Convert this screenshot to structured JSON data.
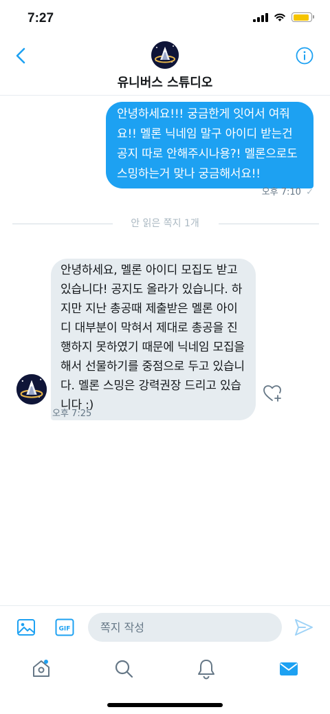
{
  "status_bar": {
    "time": "7:27"
  },
  "header": {
    "title": "유니버스 스튜디오"
  },
  "messages": [
    {
      "direction": "sent",
      "text": "안녕하세요!!! 궁금한게 잇어서 여줘요!! 멜론 닉네임 말구 아이디 받는건 공지 따로 안해주시나용?! 멜론으로도 스밍하는거 맞나 궁금해서요!!",
      "time": "오후 7:10",
      "check": "✓"
    },
    {
      "direction": "received",
      "text": "안녕하세요, 멜론 아이디 모집도 받고 있습니다! 공지도 올라가 있습니다. 하지만 지난 총공때 제출받은 멜론 아이디 대부분이 막혀서 제대로 총공을 진행하지 못하였기 때문에 닉네임 모집을 해서 선물하기를 중점으로 두고 있습니다. 멜론 스밍은 강력권장 드리고 있습니다 :)",
      "time": "오후 7:25"
    }
  ],
  "unread_divider": "안 읽은 쪽지 1개",
  "composer": {
    "placeholder": "쪽지 작성",
    "value": ""
  },
  "tabs": [
    {
      "name": "home",
      "icon": "home-icon"
    },
    {
      "name": "search",
      "icon": "search-icon"
    },
    {
      "name": "notifications",
      "icon": "bell-icon"
    },
    {
      "name": "messages",
      "icon": "mail-icon"
    }
  ],
  "colors": {
    "accent": "#1da1f2",
    "received_bubble": "#e6ecf0",
    "muted": "#657786"
  }
}
